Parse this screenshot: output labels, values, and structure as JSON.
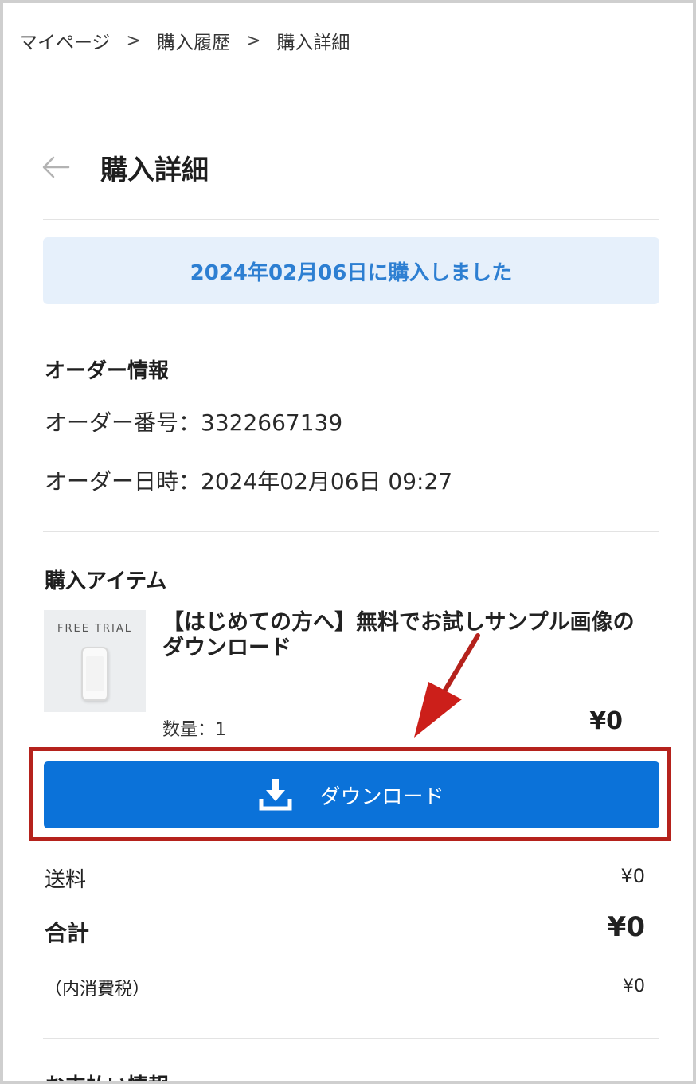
{
  "breadcrumb": {
    "items": [
      "マイページ",
      "購入履歴",
      "購入詳細"
    ],
    "separator": ">"
  },
  "header": {
    "back_icon": "arrow-left-icon",
    "title": "購入詳細"
  },
  "notice": {
    "text": "2024年02月06日に購入しました"
  },
  "order_info": {
    "heading": "オーダー情報",
    "order_number": "オーダー番号：3322667139",
    "order_datetime": "オーダー日時：2024年02月06日 09:27"
  },
  "items": {
    "heading": "購入アイテム",
    "thumbnail_text": "FREE TRIAL",
    "title": "【はじめての方へ】無料でお試しサンプル画像のダウンロード",
    "quantity": "数量：1",
    "price": "¥0"
  },
  "download_button": {
    "label": "ダウンロード",
    "icon": "download-icon"
  },
  "summary": {
    "shipping_label": "送料",
    "shipping_value": "¥0",
    "total_label": "合計",
    "total_value": "¥0",
    "tax_label": "（内消費税）",
    "tax_value": "¥0"
  },
  "payment": {
    "heading": "お支払い情報"
  },
  "colors": {
    "accent": "#0b72d9",
    "notice_bg": "#e6f0fb",
    "notice_text": "#2d7fd2",
    "annotation": "#b5221c"
  }
}
